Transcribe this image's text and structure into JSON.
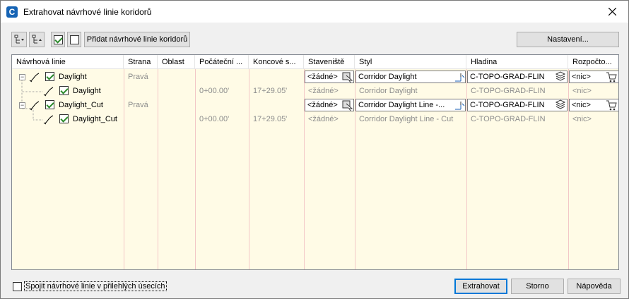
{
  "window": {
    "title": "Extrahovat návrhové linie koridorů"
  },
  "toolbar": {
    "add_label": "Přidat návrhové linie koridorů",
    "settings_label": "Nastavení..."
  },
  "columns": [
    "Návrhová linie",
    "Strana",
    "Oblast",
    "Počáteční ...",
    "Koncové s...",
    "Staveniště",
    "Styl",
    "Hladina",
    "Rozpočto..."
  ],
  "rows": [
    {
      "name": "Daylight",
      "side": "Pravá",
      "region": "",
      "start": "",
      "end": "",
      "site": "<žádné>",
      "style": "Corridor Daylight",
      "layer": "C-TOPO-GRAD-FLIN",
      "budget": "<nic>"
    },
    {
      "name": "Daylight",
      "side": "",
      "region": "",
      "start": "0+00.00'",
      "end": "17+29.05'",
      "site": "<žádné>",
      "style": "Corridor Daylight",
      "layer": "C-TOPO-GRAD-FLIN",
      "budget": "<nic>"
    },
    {
      "name": "Daylight_Cut",
      "side": "Pravá",
      "region": "",
      "start": "",
      "end": "",
      "site": "<žádné>",
      "style": "Corridor Daylight Line -...",
      "layer": "C-TOPO-GRAD-FLIN",
      "budget": "<nic>"
    },
    {
      "name": "Daylight_Cut",
      "side": "",
      "region": "",
      "start": "0+00.00'",
      "end": "17+29.05'",
      "site": "<žádné>",
      "style": "Corridor Daylight Line - Cut",
      "layer": "C-TOPO-GRAD-FLIN",
      "budget": "<nic>"
    }
  ],
  "footer": {
    "join_label": "Spojit návrhové linie v přilehlých úsecích",
    "extract_label": "Extrahovat",
    "cancel_label": "Storno",
    "help_label": "Nápověda"
  },
  "colors": {
    "grid_bg": "#fffbe6",
    "accent": "#0078d7",
    "check": "#2b8a2b"
  }
}
